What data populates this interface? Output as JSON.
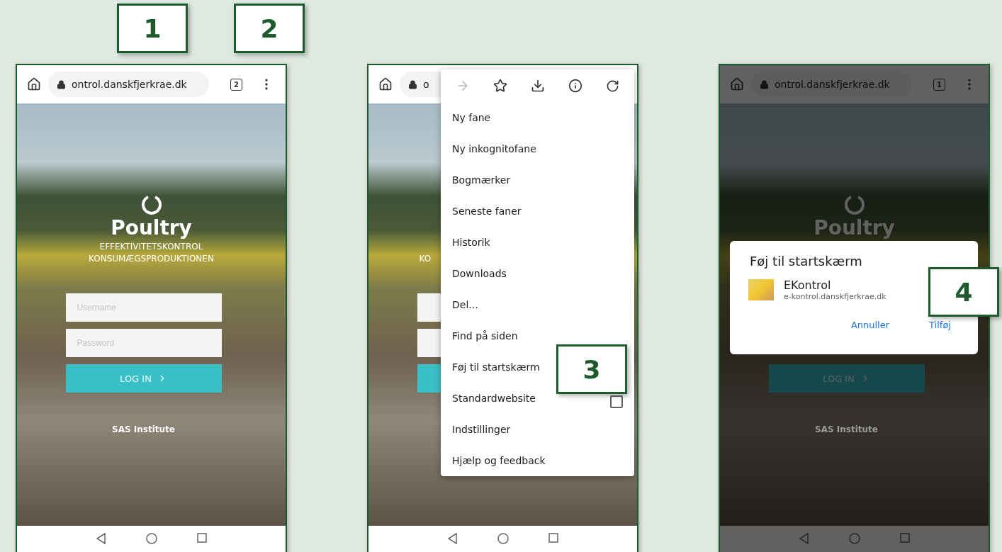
{
  "callouts": [
    "1",
    "2",
    "3",
    "4"
  ],
  "phones": [
    {
      "kind": "login",
      "address": "ontrol.danskfjerkrae.dk",
      "tab_count": "2",
      "dimmed": false,
      "page": {
        "title": "Poultry",
        "subtitle": [
          "EFFEKTIVITETSKONTROL",
          "KONSUMÆGSPRODUKTIONEN"
        ],
        "username_placeholder": "Username",
        "password_placeholder": "Password",
        "login_button": "LOG IN",
        "footer": "SAS Institute"
      }
    },
    {
      "kind": "menu",
      "address": "o",
      "dimmed": false,
      "page": {
        "subtitle": [
          "KO"
        ]
      },
      "menu": {
        "items": [
          {
            "label": "Ny fane"
          },
          {
            "label": "Ny inkognitofane"
          },
          {
            "label": "Bogmærker"
          },
          {
            "label": "Seneste faner"
          },
          {
            "label": "Historik"
          },
          {
            "label": "Downloads"
          },
          {
            "label": "Del..."
          },
          {
            "label": "Find på siden"
          },
          {
            "label": "Føj til startskærm"
          },
          {
            "label": "Standardwebsite",
            "checked": false
          },
          {
            "label": "Indstillinger"
          },
          {
            "label": "Hjælp og feedback"
          }
        ]
      }
    },
    {
      "kind": "dialog",
      "address": "ontrol.danskfjerkrae.dk",
      "tab_count": "1",
      "dimmed": true,
      "page": {
        "title": "Poultry",
        "login_button": "LOG IN",
        "footer": "SAS Institute"
      },
      "dialog": {
        "title": "Føj til startskærm",
        "app_name": "EKontrol",
        "app_url": "e-kontrol.danskfjerkrae.dk",
        "buttons": [
          "Annuller",
          "Tilføj"
        ]
      }
    }
  ]
}
